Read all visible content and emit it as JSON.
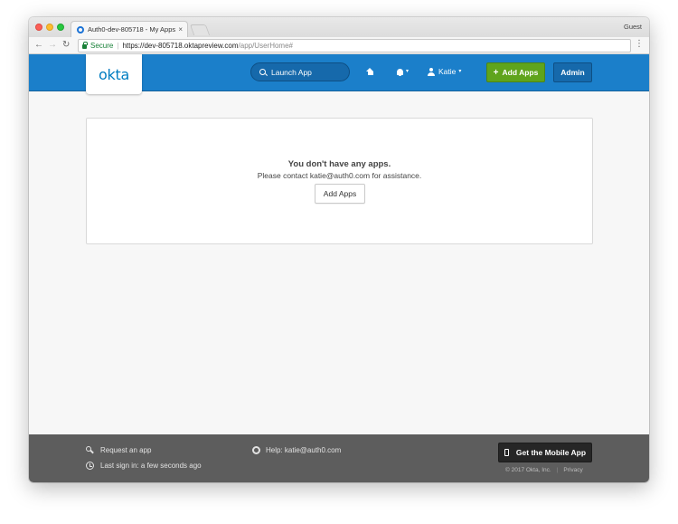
{
  "browser": {
    "tab_title": "Auth0-dev-805718 - My Apps",
    "tab_close": "×",
    "profile": "Guest",
    "nav": {
      "back": "←",
      "forward": "→",
      "reload": "↻",
      "menu": "⋮"
    },
    "address": {
      "secure_label": "Secure",
      "separator": "|",
      "url_main": "https://dev-805718.oktapreview.com",
      "url_path": "/app/UserHome#"
    }
  },
  "header": {
    "logo": "okta",
    "launch_placeholder": "Launch App",
    "user_name": "Katie",
    "caret": "▾",
    "add_apps_label": "Add Apps",
    "add_apps_plus": "+",
    "admin_label": "Admin"
  },
  "content": {
    "empty_title": "You don't have any apps.",
    "empty_subtitle": "Please contact katie@auth0.com for assistance.",
    "add_apps_button": "Add Apps"
  },
  "footer": {
    "request_app": "Request an app",
    "last_sign_in": "Last sign in: a few seconds ago",
    "help": "Help: katie@auth0.com",
    "mobile_app": "Get the Mobile App",
    "copyright": "© 2017 Okta, Inc.",
    "legal_separator": "|",
    "privacy": "Privacy"
  },
  "colors": {
    "header_blue": "#1b7fca",
    "add_apps_green": "#5fa41c",
    "footer_gray": "#5d5d5d",
    "secure_green": "#188038"
  }
}
